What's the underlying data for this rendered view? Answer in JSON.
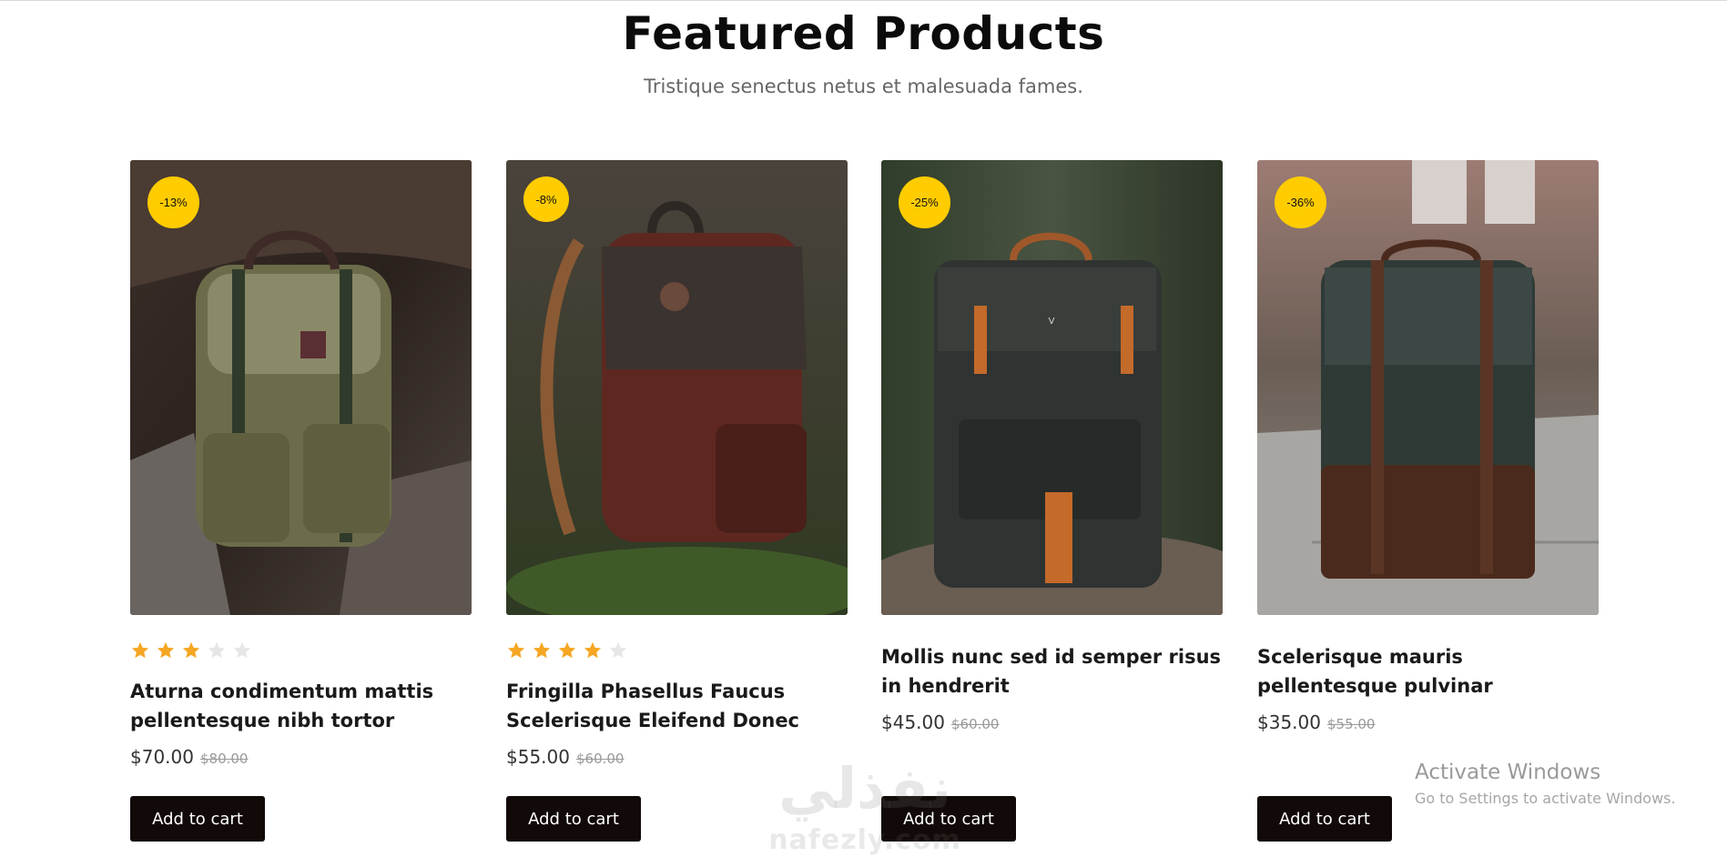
{
  "section": {
    "title": "Featured Products",
    "subtitle": "Tristique senectus netus et malesuada fames."
  },
  "colors": {
    "badge": "#ffcc00",
    "star_filled": "#f5a623",
    "star_empty": "#e6e6e6",
    "button_bg": "#120a08",
    "button_text": "#ffffff"
  },
  "products": [
    {
      "name": "Aturna condimentum mattis pellentesque nibh tortor",
      "discount": "-13%",
      "rating": 3,
      "rating_max": 5,
      "price": "$70.00",
      "old_price": "$80.00",
      "cart_label": "Add to cart",
      "image": "olive-canvas-backpack-photo"
    },
    {
      "name": "Fringilla Phasellus Faucus Scelerisque Eleifend Donec",
      "discount": "-8%",
      "rating": 4,
      "rating_max": 5,
      "price": "$55.00",
      "old_price": "$60.00",
      "cart_label": "Add to cart",
      "image": "brown-leather-backpack-photo"
    },
    {
      "name": "Mollis nunc sed id semper risus in hendrerit",
      "discount": "-25%",
      "rating": null,
      "price": "$45.00",
      "old_price": "$60.00",
      "cart_label": "Add to cart",
      "image": "black-camera-backpack-photo"
    },
    {
      "name": "Scelerisque mauris pellentesque pulvinar",
      "discount": "-36%",
      "rating": null,
      "price": "$35.00",
      "old_price": "$55.00",
      "cart_label": "Add to cart",
      "image": "green-leather-backpack-photo"
    }
  ],
  "watermark": {
    "arabic": "نفذلي",
    "latin": "nafezly.com"
  },
  "activation": {
    "title": "Activate Windows",
    "body": "Go to Settings to activate Windows."
  }
}
